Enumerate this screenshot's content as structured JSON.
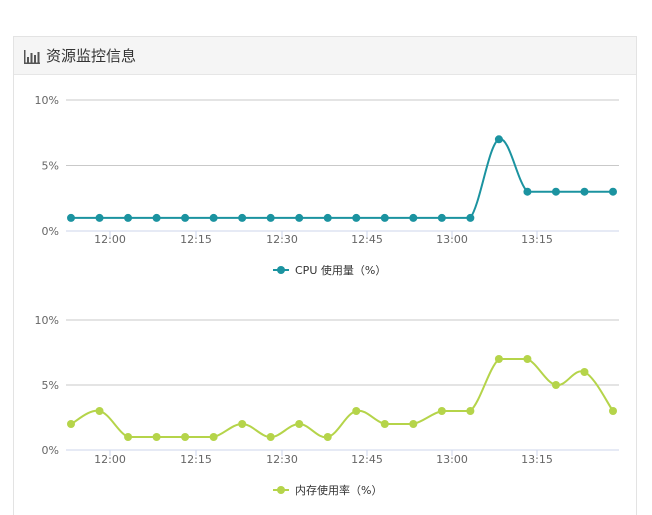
{
  "panel": {
    "title": "资源监控信息",
    "icon": "bar-chart-icon"
  },
  "chart_data": [
    {
      "type": "line",
      "x": [
        "12:00",
        "12:15",
        "12:30",
        "12:45",
        "13:00",
        "13:15"
      ],
      "yticks": [
        "10%",
        "5%",
        "0%"
      ],
      "ylim": [
        0,
        10
      ],
      "grid": true,
      "legend_position": "bottom-center",
      "series": [
        {
          "name": "CPU 使用量（%）",
          "color": "#1b93a0",
          "values": [
            1,
            1,
            1,
            1,
            1,
            1,
            1,
            1,
            1,
            1,
            1,
            1,
            1,
            1,
            1,
            7,
            3,
            3,
            3,
            3
          ]
        }
      ]
    },
    {
      "type": "line",
      "x": [
        "12:00",
        "12:15",
        "12:30",
        "12:45",
        "13:00",
        "13:15"
      ],
      "yticks": [
        "10%",
        "5%",
        "0%"
      ],
      "ylim": [
        0,
        10
      ],
      "grid": true,
      "legend_position": "bottom-center",
      "series": [
        {
          "name": "内存使用率（%）",
          "color": "#b5d44a",
          "values": [
            2,
            3,
            1,
            1,
            1,
            1,
            2,
            1,
            2,
            1,
            3,
            2,
            2,
            3,
            3,
            7,
            7,
            5,
            6,
            3
          ]
        }
      ]
    }
  ]
}
